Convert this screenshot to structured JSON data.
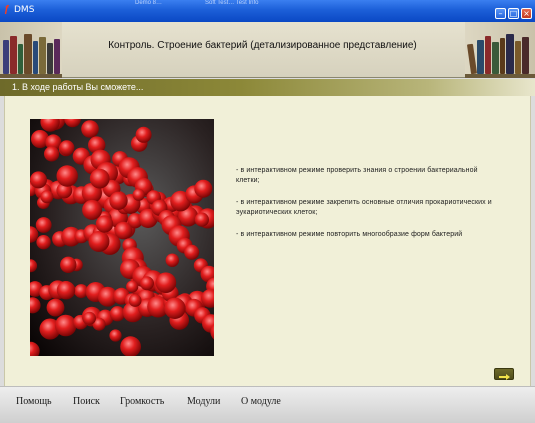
{
  "window": {
    "title": "DMS",
    "taskbar_ghost_1": "Demo 8…",
    "taskbar_ghost_2": "Soft Test… Test Info"
  },
  "header": {
    "title": "Контроль. Строение бактерий (детализированное представление)"
  },
  "section": {
    "title": "1. В ходе работы Вы сможете..."
  },
  "goals": [
    "- в интерактивном режиме проверить знания о строении бактериальной клетки;",
    "- в интерактивном режиме закрепить основные отличия прокариотических и эукариотических клеток;",
    "- в интерактивном режиме повторить многообразие форм бактерий"
  ],
  "menu": {
    "items": [
      "Помощь",
      "Поиск",
      "Громкость",
      "Модули",
      "О модуле"
    ]
  },
  "colors": {
    "band": "#8c8838",
    "content_bg": "#f1f0d8",
    "bacteria": "#d81818"
  },
  "icons": {
    "next": "arrow-right-icon",
    "minimize": "minimize-icon",
    "maximize": "maximize-icon",
    "close": "close-icon"
  }
}
